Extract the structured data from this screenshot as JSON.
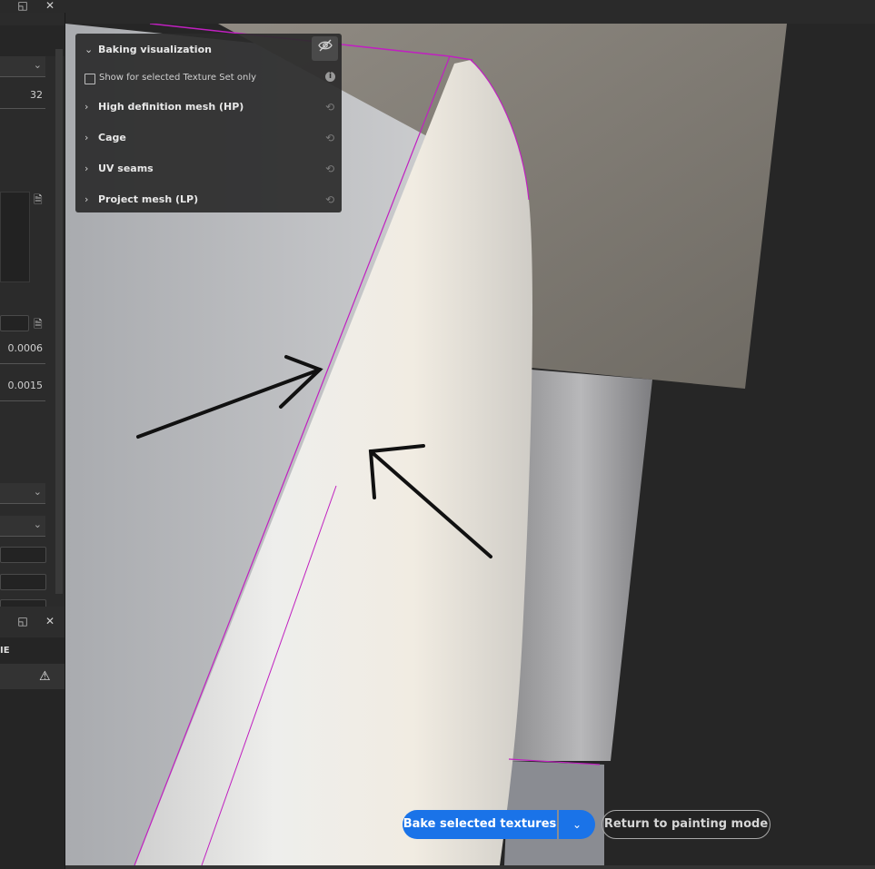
{
  "left_panel": {
    "number_field": "32",
    "value_1": "0.0006",
    "value_2": "0.0015",
    "lower_label": "IE"
  },
  "baking_panel": {
    "title": "Baking visualization",
    "show_selected_label": "Show for selected Texture Set only",
    "sections": [
      {
        "label": "High definition mesh (HP)"
      },
      {
        "label": "Cage"
      },
      {
        "label": "UV seams"
      },
      {
        "label": "Project mesh (LP)"
      }
    ]
  },
  "buttons": {
    "bake_label": "Bake selected textures",
    "return_label": "Return to painting mode"
  },
  "colors": {
    "accent": "#1a73e8",
    "uv_seam": "#c020c0",
    "annotation": "#111111"
  },
  "icons": {
    "eye": "eye-slash-icon",
    "info": "info-icon",
    "reset": "reset-icon",
    "warning": "warning-icon",
    "file": "file-icon"
  }
}
